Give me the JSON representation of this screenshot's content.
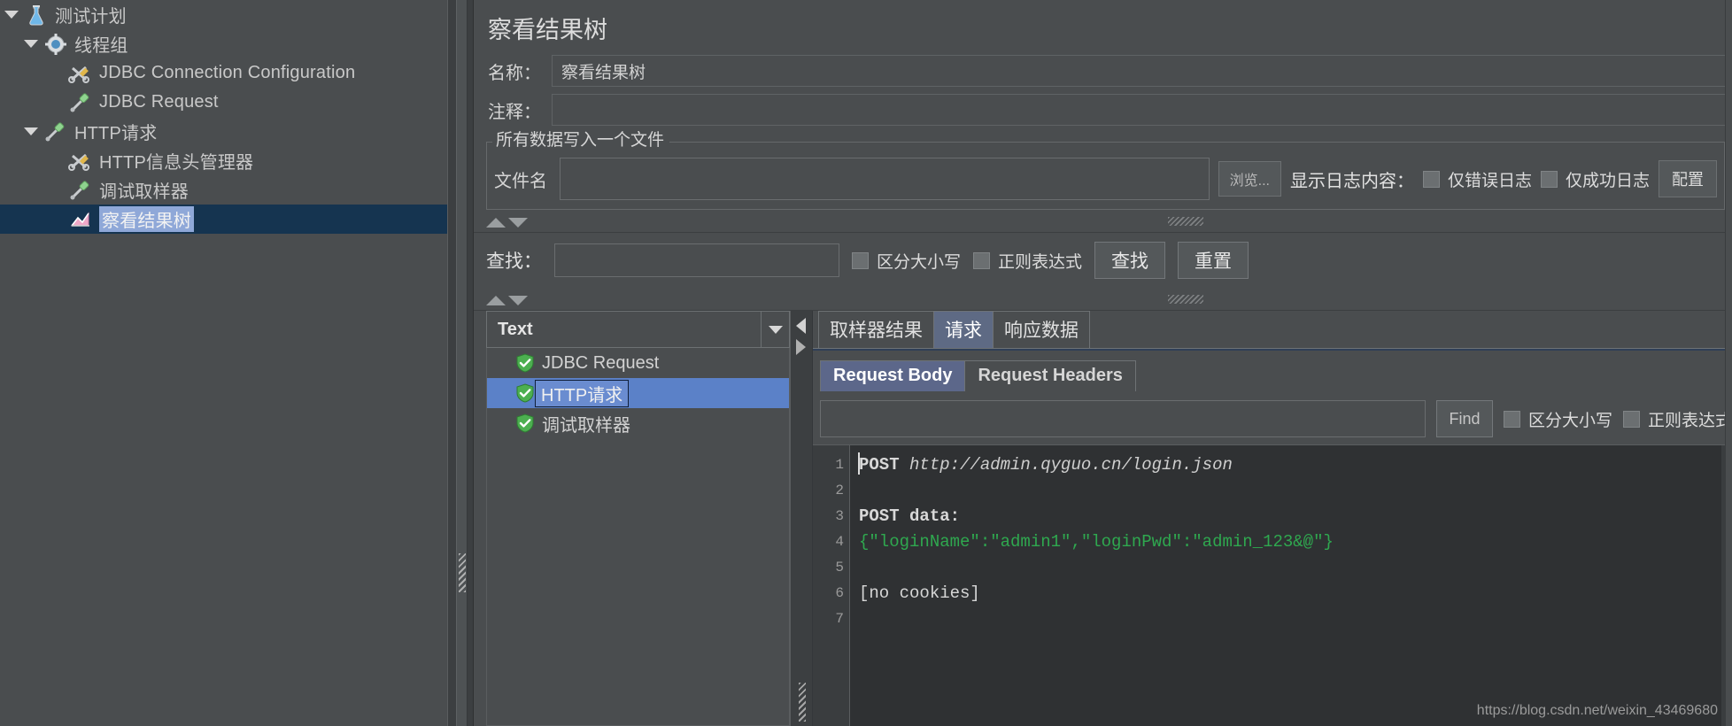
{
  "tree": {
    "items": [
      {
        "label": "测试计划",
        "icon": "test-plan-icon",
        "indent": 0,
        "twisty": "open",
        "selected": false
      },
      {
        "label": "线程组",
        "icon": "thread-group-icon",
        "indent": 1,
        "twisty": "open",
        "selected": false
      },
      {
        "label": "JDBC Connection Configuration",
        "icon": "config-element-icon",
        "indent": 2,
        "twisty": "none",
        "selected": false
      },
      {
        "label": "JDBC Request",
        "icon": "sampler-icon",
        "indent": 2,
        "twisty": "none",
        "selected": false
      },
      {
        "label": "HTTP请求",
        "icon": "sampler-icon",
        "indent": 1,
        "twisty": "open",
        "selected": false
      },
      {
        "label": "HTTP信息头管理器",
        "icon": "config-element-icon",
        "indent": 2,
        "twisty": "none",
        "selected": false
      },
      {
        "label": "调试取样器",
        "icon": "sampler-icon",
        "indent": 2,
        "twisty": "none",
        "selected": false
      },
      {
        "label": "察看结果树",
        "icon": "view-results-tree-icon",
        "indent": 2,
        "twisty": "none",
        "selected": true
      }
    ]
  },
  "panel": {
    "title": "察看结果树",
    "name_label": "名称：",
    "name_value": "察看结果树",
    "comment_label": "注释：",
    "comment_value": ""
  },
  "file_group": {
    "legend": "所有数据写入一个文件",
    "filename_label": "文件名",
    "filename_value": "",
    "browse_button": "浏览...",
    "log_display_label": "显示日志内容：",
    "errors_only_label": "仅错误日志",
    "errors_only_checked": false,
    "success_only_label": "仅成功日志",
    "success_only_checked": false,
    "configure_button": "配置"
  },
  "search_bar": {
    "label": "查找：",
    "value": "",
    "case_sensitive_label": "区分大小写",
    "case_sensitive_checked": false,
    "regex_label": "正则表达式",
    "regex_checked": false,
    "search_button": "查找",
    "reset_button": "重置"
  },
  "results": {
    "render_selected": "Text",
    "rows": [
      {
        "label": "JDBC Request",
        "status": "success",
        "selected": false
      },
      {
        "label": "HTTP请求",
        "status": "success",
        "selected": true
      },
      {
        "label": "调试取样器",
        "status": "success",
        "selected": false
      }
    ]
  },
  "detail_tabs": {
    "items": [
      {
        "label": "取样器结果",
        "active": false
      },
      {
        "label": "请求",
        "active": true
      },
      {
        "label": "响应数据",
        "active": false
      }
    ]
  },
  "request_subtabs": {
    "items": [
      {
        "label": "Request Body",
        "active": true
      },
      {
        "label": "Request Headers",
        "active": false
      }
    ]
  },
  "find_row": {
    "value": "",
    "find_button": "Find",
    "case_sensitive_label": "区分大小写",
    "case_sensitive_checked": false,
    "regex_label": "正则表达式",
    "regex_checked": false
  },
  "code": {
    "line_numbers": [
      "1",
      "2",
      "3",
      "4",
      "5",
      "6",
      "7"
    ],
    "lines": [
      {
        "n": "1",
        "method": "POST",
        "url": "http://admin.qyguo.cn/login.json",
        "type": "request-line"
      },
      {
        "n": "2",
        "text": "",
        "type": "blank"
      },
      {
        "n": "3",
        "text": "POST data:",
        "type": "label"
      },
      {
        "n": "4",
        "text": "{\"loginName\":\"admin1\",\"loginPwd\":\"admin_123&@\"}",
        "type": "json"
      },
      {
        "n": "5",
        "text": "",
        "type": "blank"
      },
      {
        "n": "6",
        "text": "[no cookies]",
        "type": "plain"
      },
      {
        "n": "7",
        "text": "",
        "type": "blank"
      }
    ]
  },
  "watermark": "https://blog.csdn.net/weixin_43469680",
  "colors": {
    "panel_bg": "#4a4d4f",
    "window_bg": "#3c3f41",
    "tree_selection": "#153450",
    "list_selection": "#5b81c8",
    "active_tab": "#5e6a84",
    "code_bg": "#2f3133",
    "json_green": "#2fa84f",
    "text": "#d2d2d2"
  }
}
